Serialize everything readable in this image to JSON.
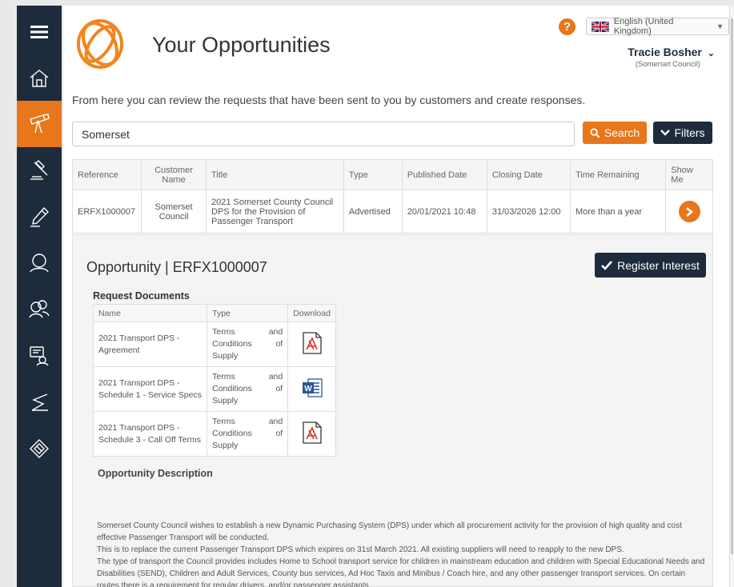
{
  "sidebar": {
    "items": [
      {
        "name": "menu",
        "icon": "hamburger-menu-icon",
        "active": false
      },
      {
        "name": "home",
        "icon": "home-icon",
        "active": false
      },
      {
        "name": "opportunities",
        "icon": "telescope-icon",
        "active": true
      },
      {
        "name": "auctions",
        "icon": "gavel-icon",
        "active": false
      },
      {
        "name": "edit",
        "icon": "pen-icon",
        "active": false
      },
      {
        "name": "profile",
        "icon": "user-icon",
        "active": false
      },
      {
        "name": "users",
        "icon": "users-icon",
        "active": false
      },
      {
        "name": "messages",
        "icon": "message-user-icon",
        "active": false
      },
      {
        "name": "contracts",
        "icon": "handshake-icon",
        "active": false
      },
      {
        "name": "tags",
        "icon": "tag-icon",
        "active": false
      }
    ]
  },
  "header": {
    "title": "Your Opportunities",
    "help_label": "?",
    "language": "English (United Kingdom)",
    "user_name": "Tracie Bosher",
    "user_org": "(Somerset Council)"
  },
  "intro": "From here you can review the requests that have been sent to you by customers and create responses.",
  "search": {
    "value": "Somerset",
    "search_label": "Search",
    "filters_label": "Filters"
  },
  "results": {
    "headers": [
      "Reference",
      "Customer Name",
      "Title",
      "Type",
      "Published Date",
      "Closing Date",
      "Time Remaining",
      "Show Me"
    ],
    "rows": [
      {
        "reference": "ERFX1000007",
        "customer": "Somerset Council",
        "title": "2021 Somerset County Council DPS for the Provision of Passenger Transport",
        "type": "Advertised",
        "published": "20/01/2021 10:48",
        "closing": "31/03/2026 12:00",
        "remaining": "More than a year"
      }
    ]
  },
  "opportunity": {
    "title": "Opportunity | ERFX1000007",
    "register_label": "Register Interest",
    "docs_heading": "Request Documents",
    "doc_headers": [
      "Name",
      "Type",
      "Download"
    ],
    "documents": [
      {
        "name": "2021 Transport DPS - Agreement",
        "type": [
          "Terms",
          "and",
          "Conditions",
          "of",
          "Supply"
        ],
        "file": "pdf"
      },
      {
        "name": "2021 Transport DPS - Schedule 1 - Service Specs",
        "type": [
          "Terms",
          "and",
          "Conditions",
          "of",
          "Supply"
        ],
        "file": "word"
      },
      {
        "name": "2021 Transport DPS - Schedule 3 - Call Off Terms",
        "type": [
          "Terms",
          "and",
          "Conditions",
          "of",
          "Supply"
        ],
        "file": "pdf"
      }
    ],
    "desc_heading": "Opportunity Description",
    "description": [
      "Somerset County Council wishes to establish a new Dynamic Purchasing System (DPS) under which all procurement activity for the provision of high quality and cost effective Passenger Transport will be conducted.",
      "This is to replace the current Passenger Transport DPS which expires on 31st March 2021. All existing suppliers will need to reapply to the new DPS.",
      "The type of transport the Council provides includes Home to School transport service for children in mainstream education and children with Special Educational Needs and Disabilities (SEND), Children and Adult Services, County bus services, Ad Hoc Taxis and Minibus / Coach hire, and any other passenger transport services. On certain routes there is a requirement for regular drivers, and/or passenger assistants."
    ]
  },
  "colors": {
    "accent": "#e8761b",
    "navy": "#1e2b3c"
  }
}
